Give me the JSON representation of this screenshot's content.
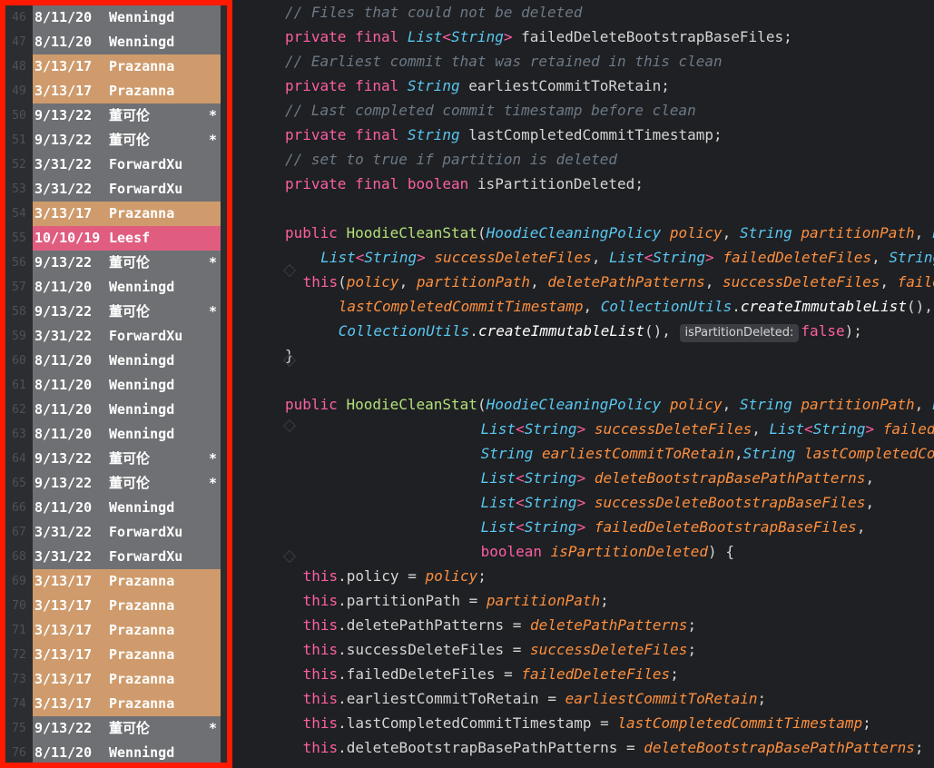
{
  "blame": {
    "rows": [
      {
        "line": "46",
        "date": "8/11/20",
        "author": "Wenningd",
        "mark": "",
        "color": "c0"
      },
      {
        "line": "47",
        "date": "8/11/20",
        "author": "Wenningd",
        "mark": "",
        "color": "c0"
      },
      {
        "line": "48",
        "date": "3/13/17",
        "author": "Prazanna",
        "mark": "",
        "color": "c1"
      },
      {
        "line": "49",
        "date": "3/13/17",
        "author": "Prazanna",
        "mark": "",
        "color": "c1"
      },
      {
        "line": "50",
        "date": "9/13/22",
        "author": "董可伦",
        "mark": "*",
        "color": "c2"
      },
      {
        "line": "51",
        "date": "9/13/22",
        "author": "董可伦",
        "mark": "*",
        "color": "c2"
      },
      {
        "line": "52",
        "date": "3/31/22",
        "author": "ForwardXu",
        "mark": "",
        "color": "c4"
      },
      {
        "line": "53",
        "date": "3/31/22",
        "author": "ForwardXu",
        "mark": "",
        "color": "c4"
      },
      {
        "line": "54",
        "date": "3/13/17",
        "author": "Prazanna",
        "mark": "",
        "color": "c1"
      },
      {
        "line": "55",
        "date": "10/10/19",
        "author": "Leesf",
        "mark": "",
        "color": "c3"
      },
      {
        "line": "56",
        "date": "9/13/22",
        "author": "董可伦",
        "mark": "*",
        "color": "c2"
      },
      {
        "line": "57",
        "date": "8/11/20",
        "author": "Wenningd",
        "mark": "",
        "color": "c0"
      },
      {
        "line": "58",
        "date": "9/13/22",
        "author": "董可伦",
        "mark": "*",
        "color": "c2"
      },
      {
        "line": "59",
        "date": "3/31/22",
        "author": "ForwardXu",
        "mark": "",
        "color": "c4"
      },
      {
        "line": "60",
        "date": "8/11/20",
        "author": "Wenningd",
        "mark": "",
        "color": "c0"
      },
      {
        "line": "61",
        "date": "8/11/20",
        "author": "Wenningd",
        "mark": "",
        "color": "c0"
      },
      {
        "line": "62",
        "date": "8/11/20",
        "author": "Wenningd",
        "mark": "",
        "color": "c0"
      },
      {
        "line": "63",
        "date": "8/11/20",
        "author": "Wenningd",
        "mark": "",
        "color": "c0"
      },
      {
        "line": "64",
        "date": "9/13/22",
        "author": "董可伦",
        "mark": "*",
        "color": "c2"
      },
      {
        "line": "65",
        "date": "9/13/22",
        "author": "董可伦",
        "mark": "*",
        "color": "c2"
      },
      {
        "line": "66",
        "date": "8/11/20",
        "author": "Wenningd",
        "mark": "",
        "color": "c0"
      },
      {
        "line": "67",
        "date": "3/31/22",
        "author": "ForwardXu",
        "mark": "",
        "color": "c4"
      },
      {
        "line": "68",
        "date": "3/31/22",
        "author": "ForwardXu",
        "mark": "",
        "color": "c4"
      },
      {
        "line": "69",
        "date": "3/13/17",
        "author": "Prazanna",
        "mark": "",
        "color": "c1"
      },
      {
        "line": "70",
        "date": "3/13/17",
        "author": "Prazanna",
        "mark": "",
        "color": "c1"
      },
      {
        "line": "71",
        "date": "3/13/17",
        "author": "Prazanna",
        "mark": "",
        "color": "c1"
      },
      {
        "line": "72",
        "date": "3/13/17",
        "author": "Prazanna",
        "mark": "",
        "color": "c1"
      },
      {
        "line": "73",
        "date": "3/13/17",
        "author": "Prazanna",
        "mark": "",
        "color": "c1"
      },
      {
        "line": "74",
        "date": "3/13/17",
        "author": "Prazanna",
        "mark": "",
        "color": "c1"
      },
      {
        "line": "75",
        "date": "9/13/22",
        "author": "董可伦",
        "mark": "*",
        "color": "c2"
      },
      {
        "line": "76",
        "date": "8/11/20",
        "author": "Wenningd",
        "mark": "",
        "color": "c0"
      }
    ]
  },
  "colors": {
    "highlight_border": "#ff1a00",
    "keyword": "#fc5fa3",
    "type": "#58c8f2",
    "comment": "#6c7986",
    "function": "#b2e07a",
    "parameter": "#fd8f3f"
  },
  "code": {
    "lines": [
      {
        "indent": 0,
        "tokens": [
          [
            "cm",
            "// Files that could not be deleted"
          ]
        ]
      },
      {
        "indent": 0,
        "tokens": [
          [
            "kw",
            "private final "
          ],
          [
            "ty",
            "List"
          ],
          [
            "kw",
            "<"
          ],
          [
            "ty",
            "String"
          ],
          [
            "kw",
            "> "
          ],
          [
            "id",
            "failedDeleteBootstrapBaseFiles;"
          ]
        ]
      },
      {
        "indent": 0,
        "tokens": [
          [
            "cm",
            "// Earliest commit that was retained in this clean"
          ]
        ]
      },
      {
        "indent": 0,
        "tokens": [
          [
            "kw",
            "private final "
          ],
          [
            "ty",
            "String "
          ],
          [
            "id",
            "earliestCommitToRetain;"
          ]
        ]
      },
      {
        "indent": 0,
        "tokens": [
          [
            "cm",
            "// Last completed commit timestamp before clean"
          ]
        ]
      },
      {
        "indent": 0,
        "tokens": [
          [
            "kw",
            "private final "
          ],
          [
            "ty",
            "String "
          ],
          [
            "id",
            "lastCompletedCommitTimestamp;"
          ]
        ]
      },
      {
        "indent": 0,
        "tokens": [
          [
            "cm",
            "// set to true if partition is deleted"
          ]
        ]
      },
      {
        "indent": 0,
        "tokens": [
          [
            "kw",
            "private final boolean "
          ],
          [
            "id",
            "isPartitionDeleted;"
          ]
        ]
      },
      {
        "indent": 0,
        "tokens": []
      },
      {
        "indent": 0,
        "tokens": [
          [
            "kw",
            "public "
          ],
          [
            "fn",
            "HoodieCleanStat"
          ],
          [
            "id",
            "("
          ],
          [
            "ty",
            "HoodieCleaningPolicy "
          ],
          [
            "pa",
            "policy"
          ],
          [
            "id",
            ", "
          ],
          [
            "ty",
            "String "
          ],
          [
            "pa",
            "partitionPath"
          ],
          [
            "id",
            ", "
          ],
          [
            "ty",
            "L"
          ]
        ]
      },
      {
        "indent": 4,
        "tokens": [
          [
            "ty",
            "List"
          ],
          [
            "kw",
            "<"
          ],
          [
            "ty",
            "String"
          ],
          [
            "kw",
            "> "
          ],
          [
            "pa",
            "successDeleteFiles"
          ],
          [
            "id",
            ", "
          ],
          [
            "ty",
            "List"
          ],
          [
            "kw",
            "<"
          ],
          [
            "ty",
            "String"
          ],
          [
            "kw",
            "> "
          ],
          [
            "pa",
            "failedDeleteFiles"
          ],
          [
            "id",
            ", "
          ],
          [
            "ty",
            "String"
          ]
        ]
      },
      {
        "indent": 2,
        "tokens": [
          [
            "kw",
            "this"
          ],
          [
            "id",
            "("
          ],
          [
            "pa",
            "policy"
          ],
          [
            "id",
            ", "
          ],
          [
            "pa",
            "partitionPath"
          ],
          [
            "id",
            ", "
          ],
          [
            "pa",
            "deletePathPatterns"
          ],
          [
            "id",
            ", "
          ],
          [
            "pa",
            "successDeleteFiles"
          ],
          [
            "id",
            ", "
          ],
          [
            "pa",
            "faile"
          ]
        ]
      },
      {
        "indent": 6,
        "tokens": [
          [
            "pa",
            "lastCompletedCommitTimestamp"
          ],
          [
            "id",
            ", "
          ],
          [
            "ty",
            "CollectionUtils"
          ],
          [
            "id",
            "."
          ],
          [
            "mc",
            "createImmutableList"
          ],
          [
            "id",
            "(),"
          ]
        ]
      },
      {
        "indent": 6,
        "tokens": [
          [
            "ty",
            "CollectionUtils"
          ],
          [
            "id",
            "."
          ],
          [
            "mc",
            "createImmutableList"
          ],
          [
            "id",
            "(), "
          ],
          [
            "hint",
            "isPartitionDeleted:"
          ],
          [
            "kw",
            "false"
          ],
          [
            "id",
            ");"
          ]
        ]
      },
      {
        "indent": 0,
        "tokens": [
          [
            "id",
            "}"
          ]
        ]
      },
      {
        "indent": 0,
        "tokens": []
      },
      {
        "indent": 0,
        "tokens": [
          [
            "kw",
            "public "
          ],
          [
            "fn",
            "HoodieCleanStat"
          ],
          [
            "id",
            "("
          ],
          [
            "ty",
            "HoodieCleaningPolicy "
          ],
          [
            "pa",
            "policy"
          ],
          [
            "id",
            ", "
          ],
          [
            "ty",
            "String "
          ],
          [
            "pa",
            "partitionPath"
          ],
          [
            "id",
            ", "
          ],
          [
            "ty",
            "L"
          ]
        ]
      },
      {
        "indent": 22,
        "tokens": [
          [
            "ty",
            "List"
          ],
          [
            "kw",
            "<"
          ],
          [
            "ty",
            "String"
          ],
          [
            "kw",
            "> "
          ],
          [
            "pa",
            "successDeleteFiles"
          ],
          [
            "id",
            ", "
          ],
          [
            "ty",
            "List"
          ],
          [
            "kw",
            "<"
          ],
          [
            "ty",
            "String"
          ],
          [
            "kw",
            "> "
          ],
          [
            "pa",
            "failed"
          ]
        ]
      },
      {
        "indent": 22,
        "tokens": [
          [
            "ty",
            "String "
          ],
          [
            "pa",
            "earliestCommitToRetain"
          ],
          [
            "id",
            ","
          ],
          [
            "ty",
            "String "
          ],
          [
            "pa",
            "lastCompletedCo"
          ]
        ]
      },
      {
        "indent": 22,
        "tokens": [
          [
            "ty",
            "List"
          ],
          [
            "kw",
            "<"
          ],
          [
            "ty",
            "String"
          ],
          [
            "kw",
            "> "
          ],
          [
            "pa",
            "deleteBootstrapBasePathPatterns"
          ],
          [
            "id",
            ","
          ]
        ]
      },
      {
        "indent": 22,
        "tokens": [
          [
            "ty",
            "List"
          ],
          [
            "kw",
            "<"
          ],
          [
            "ty",
            "String"
          ],
          [
            "kw",
            "> "
          ],
          [
            "pa",
            "successDeleteBootstrapBaseFiles"
          ],
          [
            "id",
            ","
          ]
        ]
      },
      {
        "indent": 22,
        "tokens": [
          [
            "ty",
            "List"
          ],
          [
            "kw",
            "<"
          ],
          [
            "ty",
            "String"
          ],
          [
            "kw",
            "> "
          ],
          [
            "pa",
            "failedDeleteBootstrapBaseFiles"
          ],
          [
            "id",
            ","
          ]
        ]
      },
      {
        "indent": 22,
        "tokens": [
          [
            "kw",
            "boolean "
          ],
          [
            "pa",
            "isPartitionDeleted"
          ],
          [
            "id",
            ") {"
          ]
        ]
      },
      {
        "indent": 2,
        "tokens": [
          [
            "kw",
            "this"
          ],
          [
            "id",
            ".policy = "
          ],
          [
            "pa",
            "policy"
          ],
          [
            "id",
            ";"
          ]
        ]
      },
      {
        "indent": 2,
        "tokens": [
          [
            "kw",
            "this"
          ],
          [
            "id",
            ".partitionPath = "
          ],
          [
            "pa",
            "partitionPath"
          ],
          [
            "id",
            ";"
          ]
        ]
      },
      {
        "indent": 2,
        "tokens": [
          [
            "kw",
            "this"
          ],
          [
            "id",
            ".deletePathPatterns = "
          ],
          [
            "pa",
            "deletePathPatterns"
          ],
          [
            "id",
            ";"
          ]
        ]
      },
      {
        "indent": 2,
        "tokens": [
          [
            "kw",
            "this"
          ],
          [
            "id",
            ".successDeleteFiles = "
          ],
          [
            "pa",
            "successDeleteFiles"
          ],
          [
            "id",
            ";"
          ]
        ]
      },
      {
        "indent": 2,
        "tokens": [
          [
            "kw",
            "this"
          ],
          [
            "id",
            ".failedDeleteFiles = "
          ],
          [
            "pa",
            "failedDeleteFiles"
          ],
          [
            "id",
            ";"
          ]
        ]
      },
      {
        "indent": 2,
        "tokens": [
          [
            "kw",
            "this"
          ],
          [
            "id",
            ".earliestCommitToRetain = "
          ],
          [
            "pa",
            "earliestCommitToRetain"
          ],
          [
            "id",
            ";"
          ]
        ]
      },
      {
        "indent": 2,
        "tokens": [
          [
            "kw",
            "this"
          ],
          [
            "id",
            ".lastCompletedCommitTimestamp = "
          ],
          [
            "pa",
            "lastCompletedCommitTimestamp"
          ],
          [
            "id",
            ";"
          ]
        ]
      },
      {
        "indent": 2,
        "tokens": [
          [
            "kw",
            "this"
          ],
          [
            "id",
            ".deleteBootstrapBasePathPatterns = "
          ],
          [
            "pa",
            "deleteBootstrapBasePathPatterns"
          ],
          [
            "id",
            ";"
          ]
        ]
      }
    ]
  }
}
